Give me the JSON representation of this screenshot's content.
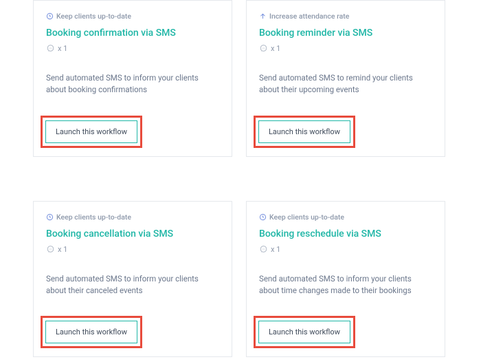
{
  "common": {
    "launch_label": "Launch this workflow",
    "meta_count": "x 1"
  },
  "tags": {
    "keep_updated": "Keep clients up-to-date",
    "increase_attendance": "Increase attendance rate"
  },
  "cards": [
    {
      "tag_key": "keep_updated",
      "tag_icon": "clock",
      "title": "Booking confirmation via SMS",
      "desc": "Send automated SMS to inform your clients about booking confirmations"
    },
    {
      "tag_key": "increase_attendance",
      "tag_icon": "arrow_up",
      "title": "Booking reminder via SMS",
      "desc": "Send automated SMS to remind your clients about their upcoming events"
    },
    {
      "tag_key": "keep_updated",
      "tag_icon": "clock",
      "title": "Booking cancellation via SMS",
      "desc": "Send automated SMS to inform your clients about their canceled events"
    },
    {
      "tag_key": "keep_updated",
      "tag_icon": "clock",
      "title": "Booking reschedule via SMS",
      "desc": "Send automated SMS to inform your clients about time changes made to their bookings"
    }
  ]
}
